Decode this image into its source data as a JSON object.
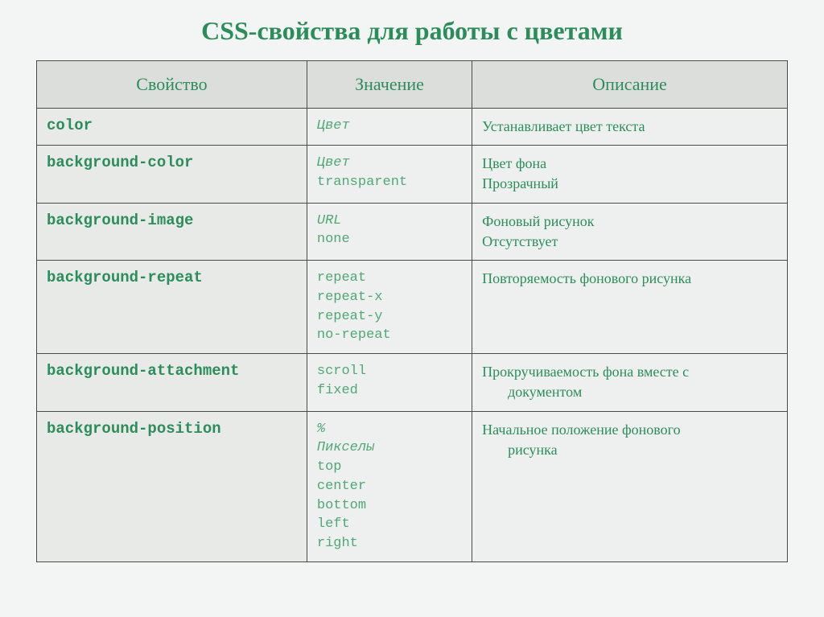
{
  "title": "CSS-свойства для работы с цветами",
  "headers": {
    "property": "Свойство",
    "value": "Значение",
    "description": "Описание"
  },
  "rows": [
    {
      "property": "color",
      "values": [
        {
          "text": "Цвет",
          "italic": true
        }
      ],
      "description": [
        "Устанавливает цвет текста"
      ]
    },
    {
      "property": "background-color",
      "values": [
        {
          "text": "Цвет",
          "italic": true
        },
        {
          "text": "transparent"
        }
      ],
      "description": [
        "Цвет фона",
        "Прозрачный"
      ]
    },
    {
      "property": "background-image",
      "values": [
        {
          "text": "URL",
          "italic": true
        },
        {
          "text": "none"
        }
      ],
      "description": [
        "Фоновый рисунок",
        "Отсутствует"
      ]
    },
    {
      "property": "background-repeat",
      "values": [
        {
          "text": "repeat"
        },
        {
          "text": "repeat-x"
        },
        {
          "text": "repeat-y"
        },
        {
          "text": "no-repeat"
        }
      ],
      "description": [
        "Повторяемость фонового рисунка"
      ]
    },
    {
      "property": "background-attachment",
      "values": [
        {
          "text": "scroll"
        },
        {
          "text": "fixed"
        }
      ],
      "description": [
        "Прокручиваемость фона вместе с",
        {
          "indent": "документом"
        }
      ]
    },
    {
      "property": "background-position",
      "values": [
        {
          "text": "%",
          "italic": true
        },
        {
          "text": "Пикселы",
          "italic": true
        },
        {
          "text": "top"
        },
        {
          "text": "center"
        },
        {
          "text": "bottom"
        },
        {
          "text": "left"
        },
        {
          "text": "right"
        }
      ],
      "description": [
        "Начальное положение фонового",
        {
          "indent": "рисунка"
        }
      ]
    }
  ]
}
